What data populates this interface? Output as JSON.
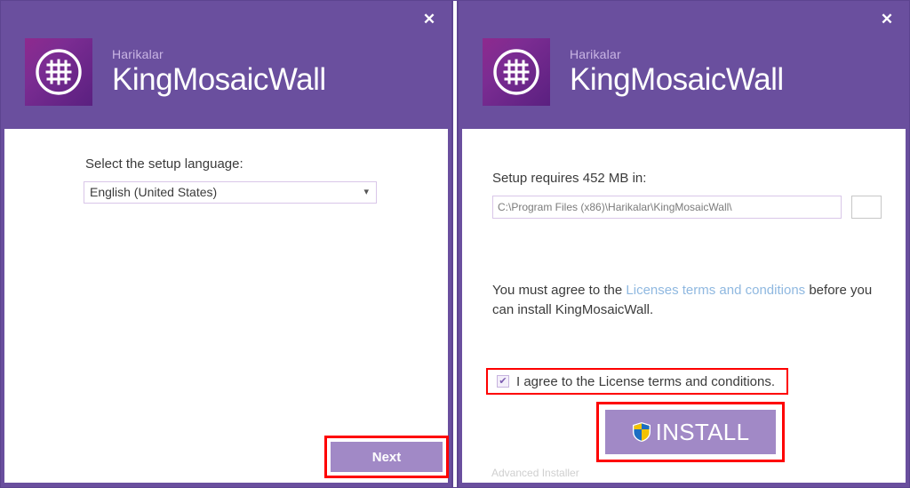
{
  "colors": {
    "header_purple": "#6a4f9e",
    "button_purple": "#a189c6",
    "annotation_red": "#fe0000",
    "link_blue": "#8fb8e0",
    "logo_gradient_start": "#8e2a8e",
    "logo_gradient_end": "#5a2080",
    "subtitle_lavender": "#c9b5e4"
  },
  "left_dialog": {
    "close_label": "✕",
    "brand": {
      "company": "Harikalar",
      "product": "KingMosaicWall",
      "logo_icon": "mosaic-grid-circle-icon"
    },
    "language_label": "Select the setup language:",
    "language_select": {
      "value": "English (United States)",
      "chevron_icon": "chevron-down-icon",
      "options": [
        "English (United States)"
      ]
    },
    "next_button": "Next"
  },
  "right_dialog": {
    "close_label": "✕",
    "brand": {
      "company": "Harikalar",
      "product": "KingMosaicWall",
      "logo_icon": "mosaic-grid-circle-icon"
    },
    "requires_label": "Setup requires 452 MB in:",
    "install_path": {
      "value": "C:\\Program Files (x86)\\Harikalar\\KingMosaicWall\\",
      "placeholder": "C:\\Program Files (x86)\\Harikalar\\KingMosaicWall\\"
    },
    "browse_button": "",
    "agreement": {
      "prefix": "You must agree to the ",
      "link": "Licenses terms and conditions",
      "suffix": " before you can install KingMosaicWall."
    },
    "checkbox": {
      "checked": true,
      "check_glyph": "✔",
      "label": "I agree to the License terms and conditions."
    },
    "install_button": {
      "label": "INSTALL",
      "shield_icon": "uac-shield-icon"
    },
    "footer": "Advanced Installer"
  }
}
